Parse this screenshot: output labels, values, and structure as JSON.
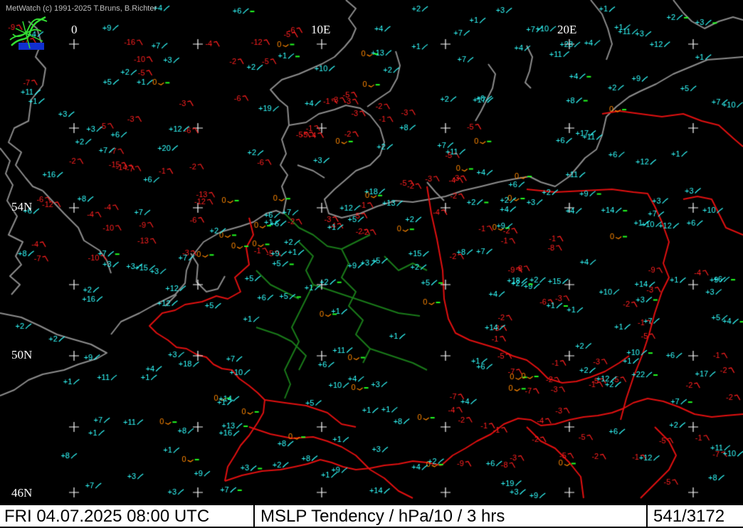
{
  "header": {
    "credit": "MetWatch  (c) 1991-2025 T.Bruns, B.Richter"
  },
  "grid_labels": {
    "lon_0": "0",
    "lon_10e": "10E",
    "lon_20e": "20E",
    "lat_54n": "54N",
    "lat_50n": "50N",
    "lat_46n": "46N"
  },
  "status_bar": {
    "datetime": "FRI 04.07.2025 08:00 UTC",
    "product": "MSLP Tendency / hPa/10 / 3 hrs",
    "station_count": "541/3172"
  },
  "colors": {
    "background": "#000000",
    "coastline": "#8c8c8c",
    "border_national": "#e01010",
    "border_regional": "#1a7a1a",
    "rising": "#33ffff",
    "falling": "#ff2020",
    "steady_zero": "#ff8800",
    "tendency_bar": "#22ff22",
    "grid_cross": "#ffffff"
  },
  "station_observations": [
    [
      "-5",
      "falling"
    ],
    [
      "-3",
      "falling"
    ],
    [
      "-2",
      "falling"
    ],
    [
      "-10",
      "falling"
    ],
    [
      "-3",
      "falling"
    ],
    [
      "-5",
      "falling"
    ],
    [
      "-12",
      "falling"
    ],
    [
      "-14",
      "falling"
    ],
    [
      "-10",
      "falling"
    ],
    [
      "-7",
      "falling"
    ],
    [
      "-1",
      "falling"
    ],
    [
      "-4",
      "falling"
    ],
    [
      "-5",
      "falling"
    ],
    [
      "-2",
      "falling"
    ],
    [
      "-5",
      "falling"
    ],
    [
      "-4",
      "falling"
    ],
    [
      "-5",
      "falling"
    ],
    [
      "-6",
      "falling"
    ],
    [
      "-5",
      "falling"
    ],
    [
      "-6",
      "falling"
    ],
    [
      "-6",
      "falling"
    ],
    [
      "-7",
      "falling"
    ],
    [
      "-7",
      "falling"
    ],
    [
      "-16",
      "falling"
    ],
    [
      "-12",
      "falling"
    ],
    [
      "-13",
      "falling"
    ],
    [
      "-12",
      "falling"
    ],
    [
      "-13",
      "falling"
    ],
    [
      "-10",
      "falling"
    ],
    [
      "-9",
      "falling"
    ],
    [
      "-9",
      "falling"
    ],
    [
      "-4",
      "falling"
    ],
    [
      "-4",
      "falling"
    ],
    [
      "-6",
      "falling"
    ],
    [
      "-5",
      "falling"
    ],
    [
      "-6",
      "falling"
    ],
    [
      "-7",
      "falling"
    ],
    [
      "-6",
      "falling"
    ],
    [
      "-7",
      "falling"
    ],
    [
      "-2",
      "falling"
    ],
    [
      "-3",
      "falling"
    ],
    [
      "-4",
      "falling"
    ],
    [
      "-1",
      "falling"
    ],
    [
      "-2",
      "falling"
    ],
    [
      "-15",
      "falling"
    ],
    [
      "-4",
      "falling"
    ],
    [
      "-5",
      "falling"
    ],
    [
      "-3",
      "falling"
    ],
    [
      "-5",
      "falling"
    ],
    [
      "-4",
      "falling"
    ],
    [
      "-3",
      "falling"
    ],
    [
      "-1",
      "falling"
    ],
    [
      "-5",
      "falling"
    ],
    [
      "-2",
      "falling"
    ],
    [
      "-2",
      "falling"
    ],
    [
      "-3",
      "falling"
    ],
    [
      "-1",
      "falling"
    ],
    [
      "-1",
      "falling"
    ],
    [
      "-2",
      "falling"
    ],
    [
      "-3",
      "falling"
    ],
    [
      "-4",
      "falling"
    ],
    [
      "-3",
      "falling"
    ],
    [
      "-5",
      "falling"
    ],
    [
      "-2",
      "falling"
    ],
    [
      "-1",
      "falling"
    ],
    [
      "-2",
      "falling"
    ],
    [
      "-3",
      "falling"
    ],
    [
      "-2",
      "falling"
    ],
    [
      "-5",
      "falling"
    ],
    [
      "-3",
      "falling"
    ],
    [
      "-4",
      "falling"
    ],
    [
      "-2",
      "falling"
    ],
    [
      "-5",
      "falling"
    ],
    [
      "-8",
      "falling"
    ],
    [
      "-6",
      "falling"
    ],
    [
      "-2",
      "falling"
    ],
    [
      "-4",
      "falling"
    ],
    [
      "-5",
      "falling"
    ],
    [
      "-1",
      "falling"
    ],
    [
      "-3",
      "falling"
    ],
    [
      "-1",
      "falling"
    ],
    [
      "-1",
      "falling"
    ],
    [
      "-2",
      "falling"
    ],
    [
      "-1",
      "falling"
    ],
    [
      "-5",
      "falling"
    ],
    [
      "-7",
      "falling"
    ],
    [
      "-4",
      "falling"
    ],
    [
      "-1",
      "falling"
    ],
    [
      "-1",
      "falling"
    ],
    [
      "-9",
      "falling"
    ],
    [
      "-5",
      "falling"
    ],
    [
      "-8",
      "falling"
    ],
    [
      "-7",
      "falling"
    ],
    [
      "-2",
      "falling"
    ],
    [
      "-2",
      "falling"
    ],
    [
      "-3",
      "falling"
    ],
    [
      "-3",
      "falling"
    ],
    [
      "-5",
      "falling"
    ],
    [
      "-1",
      "falling"
    ],
    [
      "-2",
      "falling"
    ],
    [
      "-9",
      "falling"
    ],
    [
      "-3",
      "falling"
    ],
    [
      "-1",
      "falling"
    ],
    [
      "-2",
      "falling"
    ],
    [
      "-5",
      "falling"
    ],
    [
      "-2",
      "falling"
    ],
    [
      "-3",
      "falling"
    ],
    [
      "-8",
      "falling"
    ],
    [
      "-7",
      "falling"
    ],
    [
      "-2",
      "falling"
    ],
    [
      "-1",
      "falling"
    ],
    [
      "-1",
      "falling"
    ],
    [
      "-3",
      "falling"
    ],
    [
      "-5",
      "falling"
    ],
    [
      "-3",
      "falling"
    ],
    [
      "-7",
      "falling"
    ],
    [
      "-9",
      "falling"
    ],
    [
      "-1",
      "falling"
    ],
    [
      "-2",
      "falling"
    ],
    [
      "-5",
      "falling"
    ],
    [
      "-1",
      "falling"
    ],
    [
      "-2",
      "falling"
    ],
    [
      "0",
      "steady"
    ],
    [
      "0",
      "steady"
    ],
    [
      "0",
      "steady"
    ],
    [
      "0",
      "steady"
    ],
    [
      "0",
      "steady"
    ],
    [
      "0",
      "steady"
    ],
    [
      "0",
      "steady"
    ],
    [
      "0",
      "steady"
    ],
    [
      "0",
      "steady"
    ],
    [
      "0",
      "steady"
    ],
    [
      "0",
      "steady"
    ],
    [
      "0",
      "steady"
    ],
    [
      "0",
      "steady"
    ],
    [
      "0",
      "steady"
    ],
    [
      "0",
      "steady"
    ],
    [
      "0",
      "steady"
    ],
    [
      "0",
      "steady"
    ],
    [
      "0",
      "steady"
    ],
    [
      "0",
      "steady"
    ],
    [
      "0",
      "steady"
    ],
    [
      "0",
      "steady"
    ],
    [
      "0",
      "steady"
    ],
    [
      "0",
      "steady"
    ],
    [
      "0",
      "steady"
    ],
    [
      "0",
      "steady"
    ],
    [
      "0",
      "steady"
    ],
    [
      "0",
      "steady"
    ],
    [
      "0",
      "steady"
    ],
    [
      "0",
      "steady"
    ],
    [
      "0",
      "steady"
    ],
    [
      "0",
      "steady"
    ],
    [
      "0",
      "steady"
    ],
    [
      "0",
      "steady"
    ],
    [
      "0",
      "steady"
    ],
    [
      "0",
      "steady"
    ],
    [
      "0",
      "steady"
    ],
    [
      "+3",
      "rising"
    ],
    [
      "+18",
      "rising"
    ],
    [
      "+1",
      "rising"
    ],
    [
      "+4",
      "rising"
    ],
    [
      "+4",
      "rising"
    ],
    [
      "+11",
      "rising"
    ],
    [
      "+15",
      "rising"
    ],
    [
      "+13",
      "rising"
    ],
    [
      "+14",
      "rising"
    ],
    [
      "+17",
      "rising"
    ],
    [
      "+12",
      "rising"
    ],
    [
      "+12",
      "rising"
    ],
    [
      "+14",
      "rising"
    ],
    [
      "+13",
      "rising"
    ],
    [
      "+7",
      "rising"
    ],
    [
      "+7",
      "rising"
    ],
    [
      "+4",
      "rising"
    ],
    [
      "+4",
      "rising"
    ],
    [
      "+1",
      "rising"
    ],
    [
      "+1",
      "rising"
    ],
    [
      "+2",
      "rising"
    ],
    [
      "+2",
      "rising"
    ],
    [
      "+2",
      "rising"
    ],
    [
      "+1",
      "rising"
    ],
    [
      "+2",
      "rising"
    ],
    [
      "+2",
      "rising"
    ],
    [
      "+2",
      "rising"
    ],
    [
      "+3",
      "rising"
    ],
    [
      "+2",
      "rising"
    ],
    [
      "+7",
      "rising"
    ],
    [
      "+7",
      "rising"
    ],
    [
      "+6",
      "rising"
    ],
    [
      "+7",
      "rising"
    ],
    [
      "+1",
      "rising"
    ],
    [
      "+6",
      "rising"
    ],
    [
      "+3",
      "rising"
    ],
    [
      "+3",
      "rising"
    ],
    [
      "+1",
      "rising"
    ],
    [
      "+1",
      "rising"
    ],
    [
      "+2",
      "rising"
    ],
    [
      "+3",
      "rising"
    ],
    [
      "+1",
      "rising"
    ],
    [
      "+2",
      "rising"
    ],
    [
      "+1",
      "rising"
    ],
    [
      "+4",
      "rising"
    ],
    [
      "+5",
      "rising"
    ],
    [
      "+6",
      "rising"
    ],
    [
      "+1",
      "rising"
    ],
    [
      "+3",
      "rising"
    ],
    [
      "+3",
      "rising"
    ],
    [
      "+2",
      "rising"
    ],
    [
      "+2",
      "rising"
    ],
    [
      "+1",
      "rising"
    ],
    [
      "+2",
      "rising"
    ],
    [
      "+8",
      "rising"
    ],
    [
      "+12",
      "rising"
    ],
    [
      "+6",
      "rising"
    ],
    [
      "+1",
      "rising"
    ],
    [
      "+1",
      "rising"
    ],
    [
      "+2",
      "rising"
    ],
    [
      "+1",
      "rising"
    ],
    [
      "+2",
      "rising"
    ],
    [
      "+1",
      "rising"
    ],
    [
      "+2",
      "rising"
    ],
    [
      "+3",
      "rising"
    ],
    [
      "+5",
      "rising"
    ],
    [
      "+1",
      "rising"
    ],
    [
      "+1",
      "rising"
    ],
    [
      "+6",
      "rising"
    ],
    [
      "+4",
      "rising"
    ],
    [
      "+6",
      "rising"
    ],
    [
      "+7",
      "rising"
    ],
    [
      "+7",
      "rising"
    ],
    [
      "+5",
      "rising"
    ],
    [
      "+3",
      "rising"
    ],
    [
      "+6",
      "rising"
    ],
    [
      "+5",
      "rising"
    ],
    [
      "+9",
      "rising"
    ],
    [
      "+10",
      "rising"
    ],
    [
      "+9",
      "rising"
    ],
    [
      "+10",
      "rising"
    ],
    [
      "+12",
      "rising"
    ],
    [
      "+10",
      "rising"
    ],
    [
      "+7",
      "rising"
    ],
    [
      "+8",
      "rising"
    ],
    [
      "+7",
      "rising"
    ],
    [
      "+6",
      "rising"
    ],
    [
      "+3",
      "rising"
    ],
    [
      "+3",
      "rising"
    ],
    [
      "+11",
      "rising"
    ],
    [
      "+11",
      "rising"
    ],
    [
      "+12",
      "rising"
    ],
    [
      "+7",
      "rising"
    ],
    [
      "+9",
      "rising"
    ],
    [
      "+10",
      "rising"
    ],
    [
      "+12",
      "rising"
    ],
    [
      "+9",
      "rising"
    ],
    [
      "+14",
      "rising"
    ],
    [
      "+15",
      "rising"
    ],
    [
      "+23",
      "rising"
    ],
    [
      "+13",
      "rising"
    ],
    [
      "+9",
      "rising"
    ],
    [
      "+19",
      "rising"
    ],
    [
      "+22",
      "rising"
    ],
    [
      "+18",
      "rising"
    ],
    [
      "+16",
      "rising"
    ],
    [
      "+20",
      "rising"
    ],
    [
      "+17",
      "rising"
    ],
    [
      "+11",
      "rising"
    ],
    [
      "+11",
      "rising"
    ],
    [
      "+8",
      "rising"
    ],
    [
      "+9",
      "rising"
    ],
    [
      "+5",
      "rising"
    ],
    [
      "+4",
      "rising"
    ],
    [
      "+2",
      "rising"
    ],
    [
      "+4",
      "rising"
    ],
    [
      "+8",
      "rising"
    ],
    [
      "+6",
      "rising"
    ],
    [
      "+3",
      "rising"
    ],
    [
      "+6",
      "rising"
    ],
    [
      "+6",
      "rising"
    ],
    [
      "+8",
      "rising"
    ],
    [
      "+8",
      "rising"
    ],
    [
      "+7",
      "rising"
    ],
    [
      "+4",
      "rising"
    ],
    [
      "+2",
      "rising"
    ],
    [
      "+3",
      "rising"
    ],
    [
      "+1",
      "rising"
    ],
    [
      "+1",
      "rising"
    ],
    [
      "+3",
      "rising"
    ],
    [
      "+2",
      "rising"
    ],
    [
      "+1",
      "rising"
    ],
    [
      "+1",
      "rising"
    ],
    [
      "+3",
      "rising"
    ],
    [
      "+3",
      "rising"
    ],
    [
      "+1",
      "rising"
    ],
    [
      "+1",
      "rising"
    ],
    [
      "+2",
      "rising"
    ],
    [
      "+9",
      "rising"
    ],
    [
      "+7",
      "rising"
    ],
    [
      "+2",
      "rising"
    ],
    [
      "+1",
      "rising"
    ],
    [
      "+6",
      "rising"
    ],
    [
      "+5",
      "rising"
    ],
    [
      "+6",
      "rising"
    ],
    [
      "+4",
      "rising"
    ],
    [
      "+4",
      "rising"
    ],
    [
      "+2",
      "rising"
    ],
    [
      "+4",
      "rising"
    ],
    [
      "+1",
      "rising"
    ],
    [
      "+10",
      "rising"
    ],
    [
      "+9",
      "rising"
    ],
    [
      "+10",
      "rising"
    ],
    [
      "+5",
      "rising"
    ],
    [
      "+2",
      "rising"
    ],
    [
      "+3",
      "rising"
    ],
    [
      "+4",
      "rising"
    ],
    [
      "+2",
      "rising"
    ],
    [
      "+1",
      "rising"
    ],
    [
      "+5",
      "rising"
    ],
    [
      "+4",
      "rising"
    ],
    [
      "+7",
      "rising"
    ],
    [
      "+2",
      "rising"
    ],
    [
      "+1",
      "rising"
    ],
    [
      "+1",
      "rising"
    ],
    [
      "+2",
      "rising"
    ],
    [
      "+2",
      "rising"
    ],
    [
      "+2",
      "rising"
    ],
    [
      "+8",
      "rising"
    ],
    [
      "+3",
      "rising"
    ],
    [
      "+3",
      "rising"
    ],
    [
      "+3",
      "rising"
    ],
    [
      "+8",
      "rising"
    ],
    [
      "+1",
      "rising"
    ],
    [
      "+5",
      "rising"
    ],
    [
      "+9",
      "rising"
    ],
    [
      "+9",
      "rising"
    ],
    [
      "+8",
      "rising"
    ],
    [
      "+7",
      "rising"
    ],
    [
      "+6",
      "rising"
    ],
    [
      "+11",
      "rising"
    ],
    [
      "+8",
      "rising"
    ],
    [
      "+12",
      "rising"
    ],
    [
      "+14",
      "rising"
    ],
    [
      "+7",
      "rising"
    ],
    [
      "+11",
      "rising"
    ],
    [
      "+10",
      "rising"
    ],
    [
      "+4",
      "rising"
    ],
    [
      "+11",
      "rising"
    ],
    [
      "+10",
      "rising"
    ],
    [
      "+8",
      "rising"
    ],
    [
      "+7",
      "rising"
    ],
    [
      "+7",
      "rising"
    ],
    [
      "+6",
      "rising"
    ],
    [
      "+12",
      "rising"
    ],
    [
      "+10",
      "rising"
    ],
    [
      "+11",
      "rising"
    ],
    [
      "+9",
      "rising"
    ],
    [
      "+9",
      "rising"
    ],
    [
      "+11",
      "rising"
    ],
    [
      "+12",
      "rising"
    ],
    [
      "+15",
      "rising"
    ],
    [
      "+14",
      "rising"
    ],
    [
      "+16",
      "rising"
    ],
    [
      "+19",
      "rising"
    ],
    [
      "+16",
      "rising"
    ],
    [
      "+18",
      "rising"
    ],
    [
      "+17",
      "rising"
    ],
    [
      "+10",
      "rising"
    ],
    [
      "+7",
      "rising"
    ],
    [
      "+6",
      "rising"
    ],
    [
      "+5",
      "rising"
    ],
    [
      "+4",
      "rising"
    ],
    [
      "+3",
      "rising"
    ],
    [
      "+2",
      "rising"
    ],
    [
      "+6",
      "rising"
    ],
    [
      "+5",
      "rising"
    ],
    [
      "+4",
      "rising"
    ],
    [
      "+3",
      "rising"
    ],
    [
      "+1",
      "rising"
    ],
    [
      "+3",
      "rising"
    ],
    [
      "+2",
      "rising"
    ],
    [
      "+1",
      "rising"
    ],
    [
      "+7",
      "rising"
    ],
    [
      "+6",
      "rising"
    ],
    [
      "+1",
      "rising"
    ]
  ]
}
